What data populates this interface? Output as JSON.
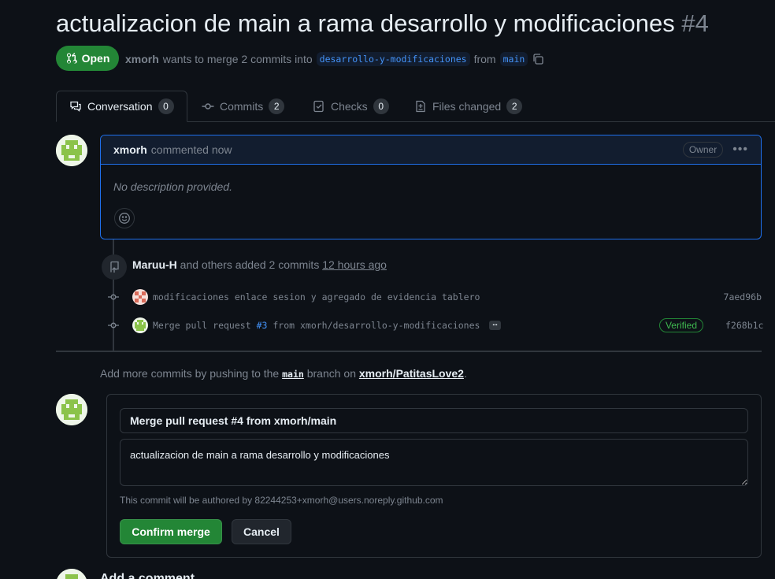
{
  "pr": {
    "title": "actualizacion de main a rama desarrollo y modificaciones",
    "number": "#4",
    "state": "Open",
    "author": "xmorh",
    "merge_text": "wants to merge 2 commits into",
    "base_branch": "desarrollo-y-modificaciones",
    "from_text": "from",
    "head_branch": "main"
  },
  "tabs": [
    {
      "label": "Conversation",
      "count": "0"
    },
    {
      "label": "Commits",
      "count": "2"
    },
    {
      "label": "Checks",
      "count": "0"
    },
    {
      "label": "Files changed",
      "count": "2"
    }
  ],
  "comment": {
    "author": "xmorh",
    "action": "commented now",
    "role": "Owner",
    "body": "No description provided."
  },
  "commits_event": {
    "actor": "Maruu-H",
    "text": "and others added 2 commits",
    "time": "12 hours ago"
  },
  "commits": [
    {
      "message": "modificaciones enlace sesion y agregado de evidencia tablero",
      "sha": "7aed96b"
    },
    {
      "message_prefix": "Merge pull request",
      "link": "#3",
      "message_suffix": "from xmorh/desarrollo-y-modificaciones",
      "ellipsis": "…",
      "verified": "Verified",
      "sha": "f268b1c"
    }
  ],
  "push_note": {
    "prefix": "Add more commits by pushing to the",
    "branch": "main",
    "middle": "branch on",
    "repo": "xmorh/PatitasLove2",
    "suffix": "."
  },
  "merge": {
    "title_value": "Merge pull request #4 from xmorh/main",
    "body_value": "actualizacion de main a rama desarrollo y modificaciones",
    "author_note": "This commit will be authored by 82244253+xmorh@users.noreply.github.com",
    "confirm_label": "Confirm merge",
    "cancel_label": "Cancel"
  },
  "add_comment": {
    "heading": "Add a comment"
  },
  "colors": {
    "background": "#0d1117",
    "accent_green": "#238636",
    "link_blue": "#4493f8",
    "border": "#30363d"
  },
  "icons": [
    "pull-request-icon",
    "copy-icon",
    "conversation-icon",
    "commit-icon",
    "checks-icon",
    "files-icon",
    "smiley-icon",
    "kebab-icon",
    "repo-push-icon"
  ]
}
